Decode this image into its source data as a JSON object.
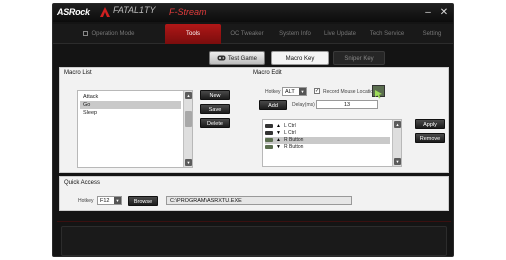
{
  "window": {
    "brand": "ASRock",
    "product": "FATAL1TY",
    "title": "F-Stream",
    "minimize_label": "–",
    "close_label": "✕"
  },
  "nav": [
    {
      "label": "Operation Mode"
    },
    {
      "label": "Tools"
    },
    {
      "label": "OC Tweaker"
    },
    {
      "label": "System Info"
    },
    {
      "label": "Live Update"
    },
    {
      "label": "Tech Service"
    },
    {
      "label": "Setting"
    }
  ],
  "subtabs": {
    "test_game": "Test Game",
    "macro_key": "Macro Key",
    "sniper_key": "Sniper Key"
  },
  "macro_list": {
    "title": "Macro List",
    "items": [
      "Attack",
      "Go",
      "Sleep"
    ],
    "selected_index": 1,
    "new_label": "New",
    "save_label": "Save",
    "delete_label": "Delete"
  },
  "macro_edit": {
    "title": "Macro Edit",
    "hotkey_label": "Hotkey",
    "hotkey_value": "ALT",
    "record_mouse_label": "Record Mouse Location",
    "record_mouse_checked": true,
    "add_label": "Add",
    "delay_label": "Delay(ms)",
    "delay_value": "13",
    "events": [
      {
        "icon": "keyboard-icon",
        "direction": "up",
        "label": "L Ctrl"
      },
      {
        "icon": "keyboard-icon",
        "direction": "down",
        "label": "L Ctrl"
      },
      {
        "icon": "mouse-icon",
        "direction": "up",
        "label": "R Button"
      },
      {
        "icon": "mouse-icon",
        "direction": "down",
        "label": "R Button"
      }
    ],
    "selected_event": 2,
    "apply_label": "Apply",
    "remove_label": "Remove"
  },
  "quick_access": {
    "title": "Quick Access",
    "hotkey_label": "Hotkey",
    "hotkey_value": "F12",
    "browse_label": "Browse",
    "path_value": "C:\\PROGRAM\\ASRXTU.EXE"
  },
  "colors": {
    "accent": "#b01717",
    "background": "#141414",
    "panel": "#f2f2f2"
  }
}
